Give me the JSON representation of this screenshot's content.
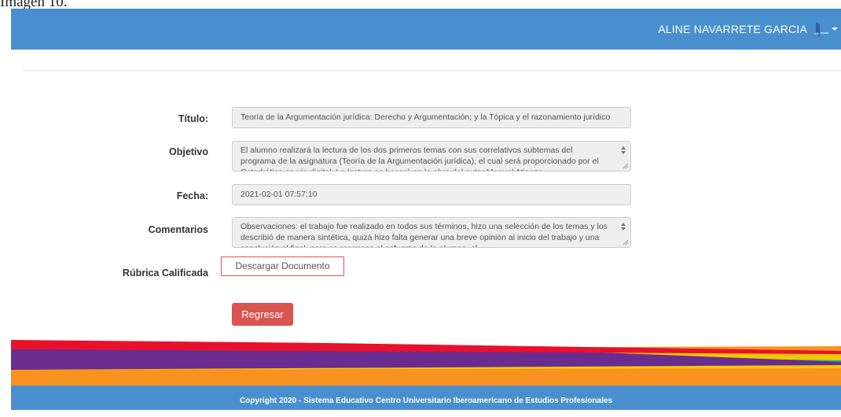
{
  "caption": "Imagen 10.",
  "header": {
    "user_name": "ALINE NAVARRETE GARCIA",
    "logo_icon": "university-logo-icon",
    "caret_icon": "caret-down-icon"
  },
  "form": {
    "titulo": {
      "label": "Título:",
      "value": "Teoría de la Argumentación jurídica: Derecho y Argumentación; y la Tópica y el razonamiento jurídico"
    },
    "objetivo": {
      "label": "Objetivo",
      "value": "El alumno realizará la lectura de los dos primeros temas con sus correlativos subtemas del programa de la asignatura (Teoría de la Argumentación jurídica), el cual será proporcionado por el Catedrático en vía digital. La lectura se basará en la obra del autor Manuel Atienza"
    },
    "fecha": {
      "label": "Fecha:",
      "value": "2021-02-01 07:57:10"
    },
    "comentarios": {
      "label": "Comentarios",
      "value": "Observaciones: el trabajo fue realizado en todos sus términos, hizo una selección de los temas y los describió de manera sintética, quizá hizo falta generar una breve opinión al inicio del trabajo y una conclusión al final, pero se reconoce el esfuerzo de la alumna, el"
    },
    "rubrica": {
      "label": "Rúbrica Calificada",
      "link_text": "Descargar Documento"
    },
    "back_button": "Regresar"
  },
  "footer": {
    "copyright": "Copyright 2020 - Sistema Educativo Centro Universitario Iberoamericano de Estudios Profesionales"
  },
  "colors": {
    "primary": "#4a8fcd",
    "danger": "#d9534f",
    "band_red": "#e8112d",
    "band_purple": "#6a2c8e",
    "band_orange": "#f7931e",
    "band_yellow": "#f5c800",
    "band_teal": "#14b2a5"
  }
}
